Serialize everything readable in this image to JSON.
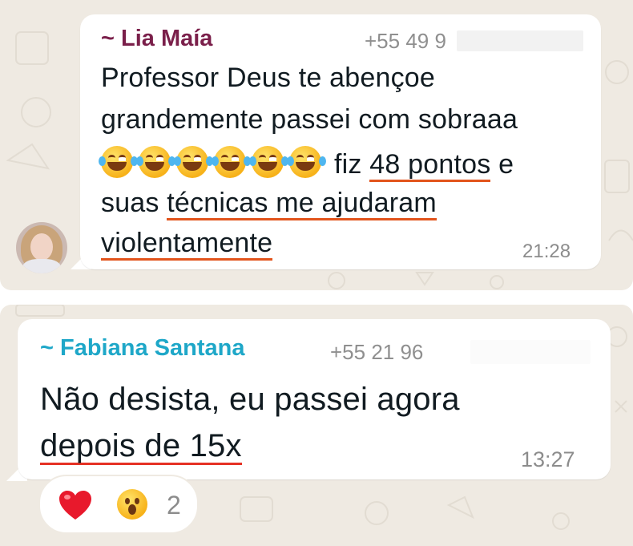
{
  "messages": [
    {
      "sender": "~ Lia Maía",
      "phone": "+55 49 9",
      "lines": [
        "Professor Deus te abençoe",
        "grandemente passei com sobraaa",
        "fiz",
        "48 pontos",
        "e",
        "suas",
        "técnicas me ajudaram",
        "violentamente"
      ],
      "emoji": [
        "face-with-tears-of-joy",
        "face-with-tears-of-joy",
        "face-with-tears-of-joy",
        "face-with-tears-of-joy",
        "face-with-tears-of-joy",
        "face-with-tears-of-joy"
      ],
      "time": "21:28"
    },
    {
      "sender": "~ Fabiana Santana",
      "phone": "+55 21 96",
      "lines": [
        "Não desista, eu passei agora",
        "depois de 15x"
      ],
      "time": "13:27",
      "reactions": {
        "emojis": [
          "red-heart",
          "face-with-open-mouth"
        ],
        "count": "2"
      }
    }
  ],
  "colors": {
    "chat_background": "#efeae2",
    "bubble": "#ffffff",
    "sender1": "#7a1f4a",
    "sender2": "#1ea7c8",
    "underline": "#e2541c"
  }
}
